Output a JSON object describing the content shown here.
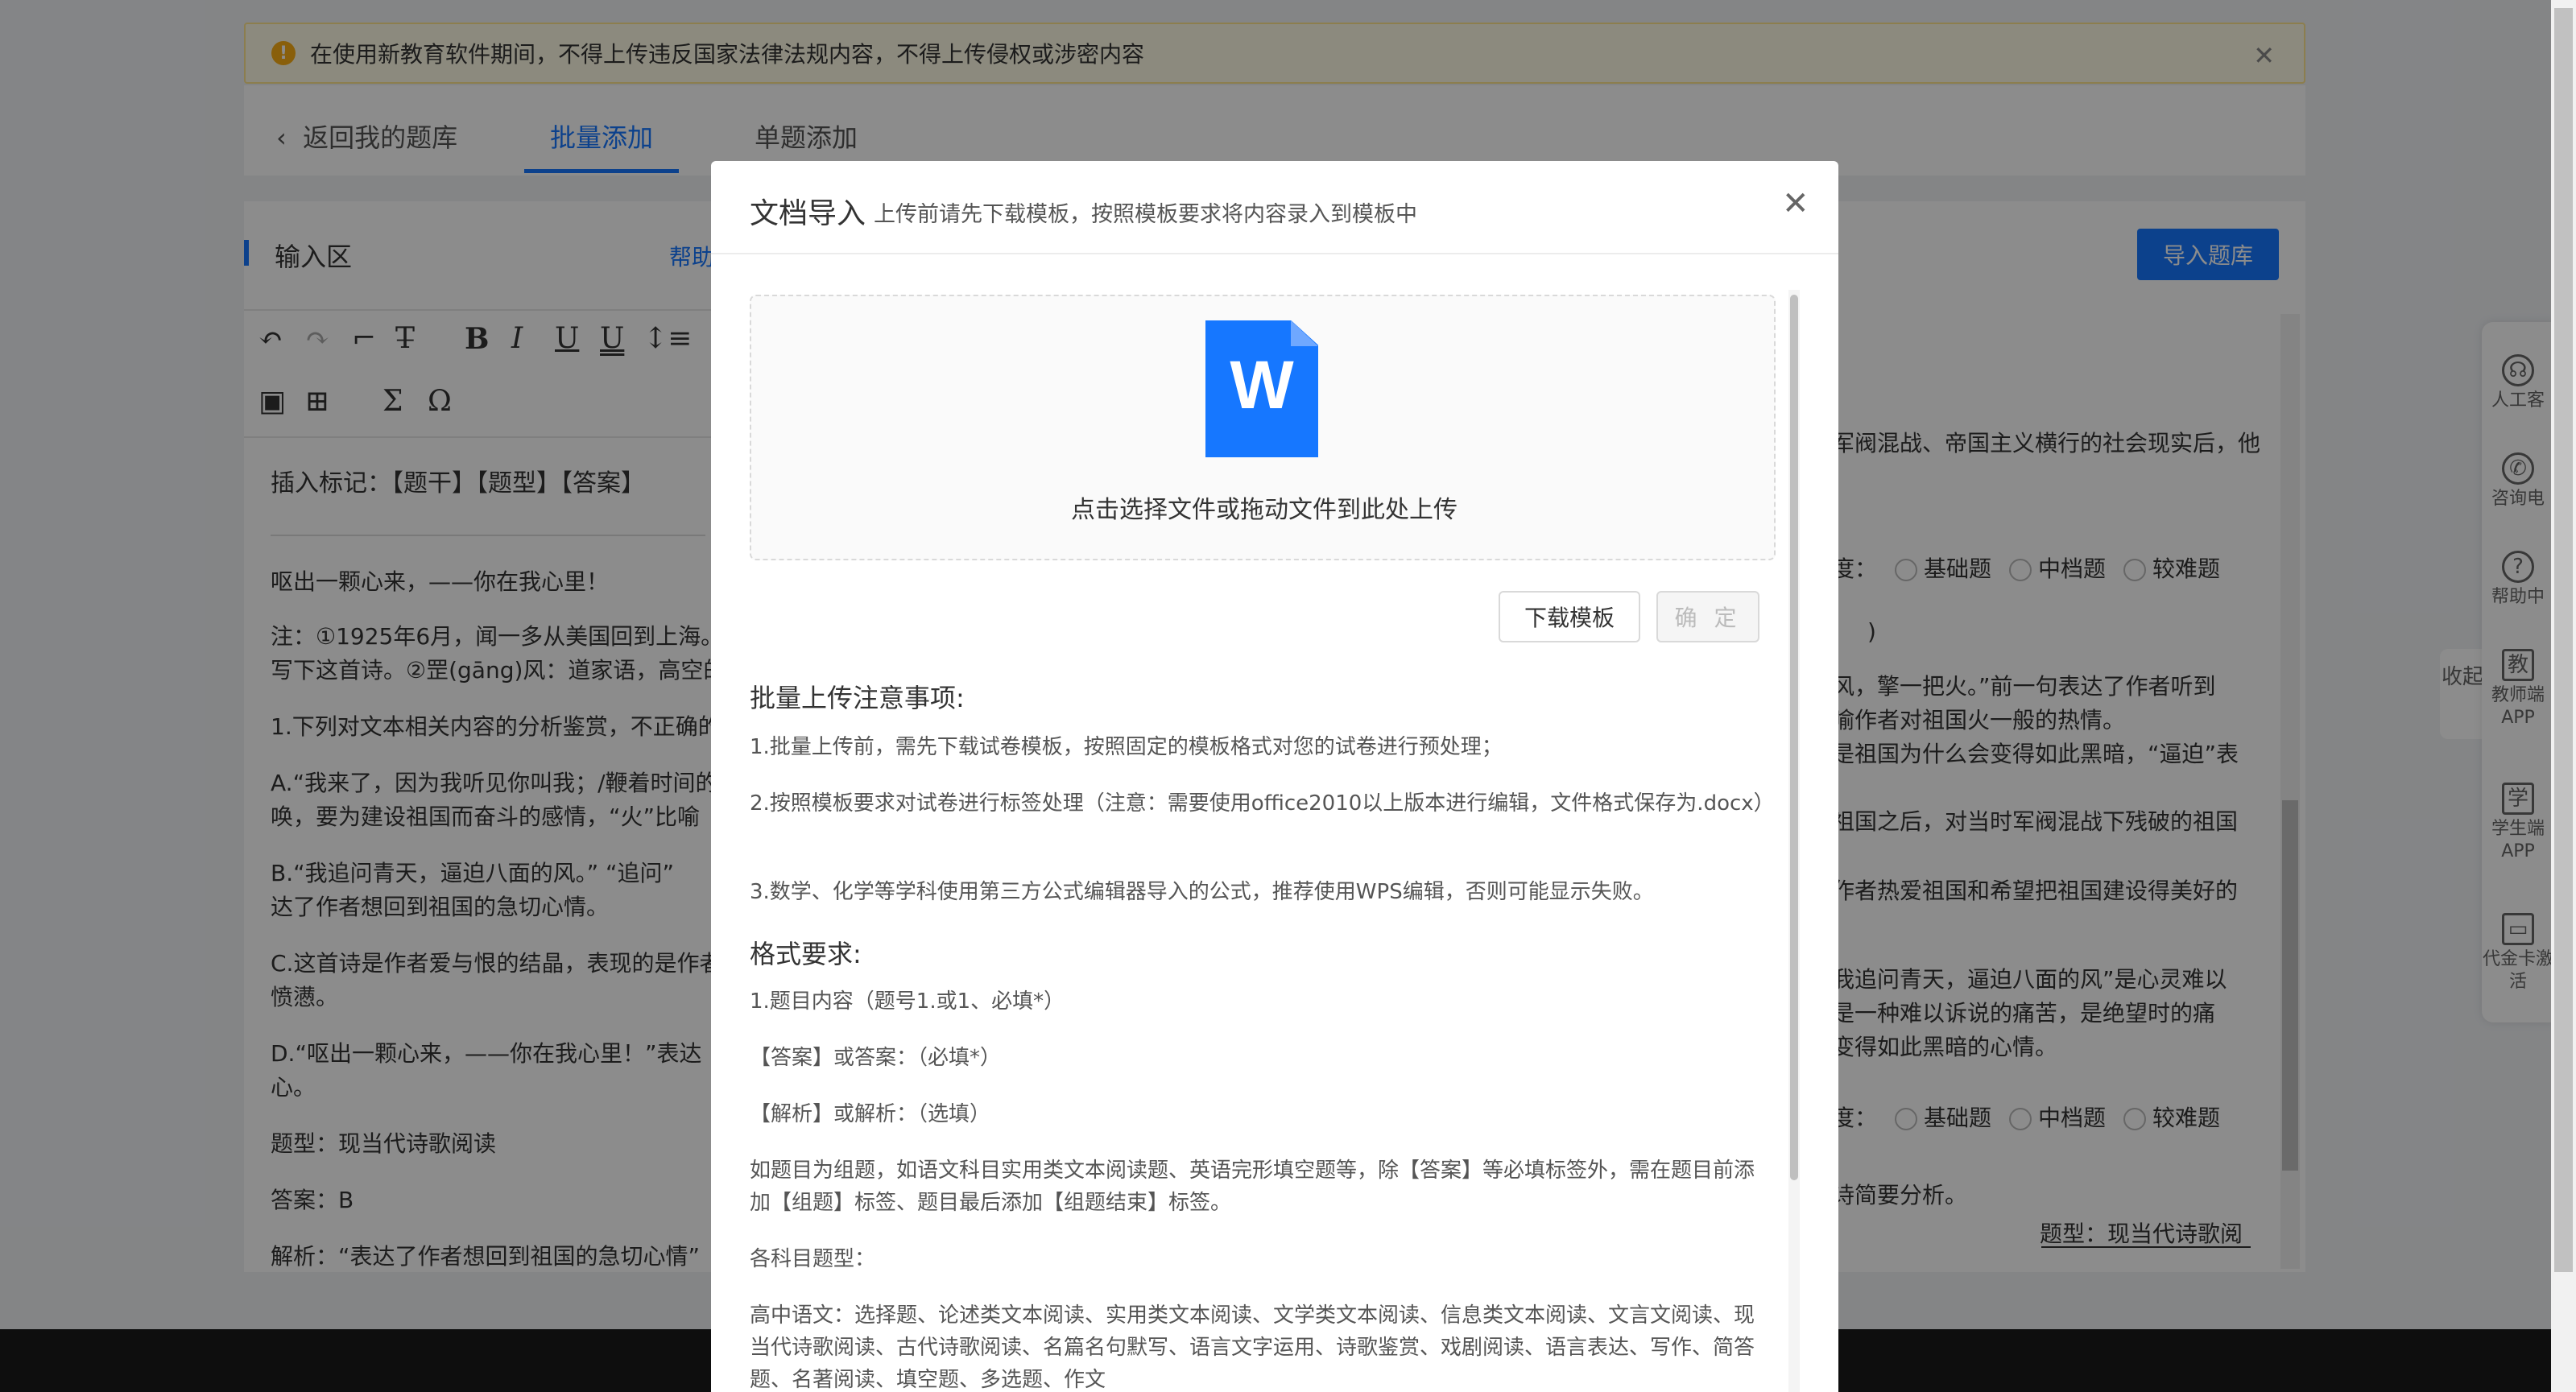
{
  "notice": {
    "text": "在使用新教育软件期间，不得上传违反国家法律法规内容，不得上传侵权或涉密内容"
  },
  "nav": {
    "back": "返回我的题库",
    "batch": "批量添加",
    "single": "单题添加"
  },
  "panel": {
    "title": "输入区",
    "help": "帮助",
    "import_button": "导入题库"
  },
  "editor": {
    "marker_label": "插入标记：【题干】【题型】【答案】",
    "lines": [
      "呕出一颗心来，——你在我心里！",
      "注：①1925年6月，闻一多从美国回到上海。",
      "写下这首诗。②罡(gāng)风：道家语，高空的",
      "1.下列对文本相关内容的分析鉴赏，不正确的",
      "A.“我来了，因为我听见你叫我；/鞭着时间的",
      "唤，要为建设祖国而奋斗的感情，“火”比喻",
      "B.“我追问青天，逼迫八面的风。” “追问”",
      "达了作者想回到祖国的急切心情。",
      "C.这首诗是作者爱与恨的结晶，表现的是作者",
      "愤懑。",
      "D.“呕出一颗心来，——你在我心里！”表达",
      "心。",
      "题型：现当代诗歌阅读",
      "答案：B",
      "解析：“表达了作者想回到祖国的急切心情”"
    ]
  },
  "preview": {
    "lines": [
      "军阀混战、帝国主义横行的社会现实后，他",
      "风，擎一把火。”前一句表达了作者听到",
      "喻作者对祖国火一般的热情。",
      "是祖国为什么会变得如此黑暗，“逼迫”表",
      "祖国之后，对当时军阀混战下残破的祖国",
      "作者热爱祖国和希望把祖国建设得美好的",
      "我追问青天，逼迫八面的风”是心灵难以",
      "是一种难以诉说的痛苦，是绝望时的痛",
      "变得如此黑暗的心情。",
      "诗简要分析。",
      "题型：现当代诗歌阅"
    ],
    "difficulty_prefix": "度：",
    "difficulty_options": [
      "基础题",
      "中档题",
      "较难题"
    ],
    "paren": ")"
  },
  "dock": {
    "items": [
      "人工客",
      "咨询电",
      "帮助中",
      "教师端APP",
      "学生端APP",
      "代金卡激活"
    ],
    "collapse": "收起"
  },
  "modal": {
    "title": "文档导入",
    "subtitle": "上传前请先下载模板，按照模板要求将内容录入到模板中",
    "upload_letter": "W",
    "upload_text": "点击选择文件或拖动文件到此处上传",
    "download_button": "下载模板",
    "confirm_button": "确 定",
    "notes_title": "批量上传注意事项:",
    "notes": [
      "1.批量上传前，需先下载试卷模板，按照固定的模板格式对您的试卷进行预处理；",
      "2.按照模板要求对试卷进行标签处理（注意：需要使用office2010以上版本进行编辑，文件格式保存为.docx）",
      "3.数学、化学等学科使用第三方公式编辑器导入的公式，推荐使用WPS编辑，否则可能显示失败。"
    ],
    "format_title": "格式要求:",
    "format_items": [
      "1.题目内容（题号1.或1、必填*）",
      "【答案】或答案：（必填*）",
      "【解析】或解析：（选填）",
      "如题目为组题，如语文科目实用类文本阅读题、英语完形填空题等，除【答案】等必填标签外，需在题目前添加【组题】标签、题目最后添加【组题结束】标签。",
      "各科目题型：",
      "高中语文：选择题、论述类文本阅读、实用类文本阅读、文学类文本阅读、信息类文本阅读、文言文阅读、现当代诗歌阅读、古代诗歌阅读、名篇名句默写、语言文字运用、诗歌鉴赏、戏剧阅读、语言表达、写作、简答题、名著阅读、填空题、多选题、作文"
    ]
  },
  "colors": {
    "primary": "#1677ff",
    "notice_bg": "#fffbe6",
    "notice_border": "#ffe58f",
    "warn": "#faad14"
  }
}
